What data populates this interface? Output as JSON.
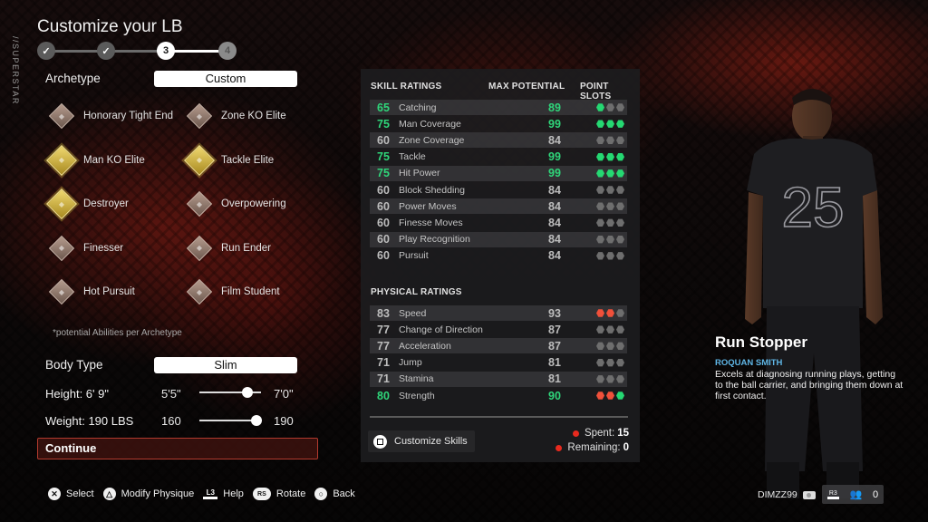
{
  "side_label": "//SUPERSTAR",
  "header": {
    "title": "Customize your LB",
    "steps": [
      {
        "label": "✓",
        "state": "done"
      },
      {
        "label": "✓",
        "state": "done"
      },
      {
        "label": "3",
        "state": "current"
      },
      {
        "label": "4",
        "state": "future"
      }
    ]
  },
  "archetype": {
    "label": "Archetype",
    "value": "Custom",
    "abilities": [
      {
        "name": "Honorary Tight End",
        "tier": "bronze"
      },
      {
        "name": "Zone KO Elite",
        "tier": "bronze"
      },
      {
        "name": "Man KO Elite",
        "tier": "gold"
      },
      {
        "name": "Tackle Elite",
        "tier": "gold"
      },
      {
        "name": "Destroyer",
        "tier": "gold"
      },
      {
        "name": "Overpowering",
        "tier": "bronze"
      },
      {
        "name": "Finesser",
        "tier": "bronze"
      },
      {
        "name": "Run Ender",
        "tier": "bronze"
      },
      {
        "name": "Hot Pursuit",
        "tier": "bronze"
      },
      {
        "name": "Film Student",
        "tier": "bronze"
      }
    ],
    "footnote": "*potential Abilities per Archetype"
  },
  "body": {
    "body_type_label": "Body Type",
    "body_type_value": "Slim",
    "height_label": "Height: 6' 9\"",
    "height_min": "5'5\"",
    "height_max": "7'0\"",
    "height_fraction": 0.78,
    "weight_label": "Weight: 190 LBS",
    "weight_min": "160",
    "weight_max": "190",
    "weight_fraction": 1.0,
    "continue_label": "Continue"
  },
  "ratings": {
    "skill_header": "SKILL RATINGS",
    "max_header": "MAX POTENTIAL",
    "slots_header": "POINT SLOTS",
    "skill": [
      {
        "current": "65",
        "name": "Catching",
        "max": "89",
        "up": true,
        "slots": [
          "g",
          "n",
          "n"
        ]
      },
      {
        "current": "75",
        "name": "Man Coverage",
        "max": "99",
        "up": true,
        "slots": [
          "g",
          "g",
          "g"
        ]
      },
      {
        "current": "60",
        "name": "Zone Coverage",
        "max": "84",
        "up": false,
        "slots": [
          "n",
          "n",
          "n"
        ]
      },
      {
        "current": "75",
        "name": "Tackle",
        "max": "99",
        "up": true,
        "slots": [
          "g",
          "g",
          "g"
        ]
      },
      {
        "current": "75",
        "name": "Hit Power",
        "max": "99",
        "up": true,
        "slots": [
          "g",
          "g",
          "g"
        ]
      },
      {
        "current": "60",
        "name": "Block Shedding",
        "max": "84",
        "up": false,
        "slots": [
          "n",
          "n",
          "n"
        ]
      },
      {
        "current": "60",
        "name": "Power Moves",
        "max": "84",
        "up": false,
        "slots": [
          "n",
          "n",
          "n"
        ]
      },
      {
        "current": "60",
        "name": "Finesse Moves",
        "max": "84",
        "up": false,
        "slots": [
          "n",
          "n",
          "n"
        ]
      },
      {
        "current": "60",
        "name": "Play Recognition",
        "max": "84",
        "up": false,
        "slots": [
          "n",
          "n",
          "n"
        ]
      },
      {
        "current": "60",
        "name": "Pursuit",
        "max": "84",
        "up": false,
        "slots": [
          "n",
          "n",
          "n"
        ]
      }
    ],
    "physical_header": "PHYSICAL RATINGS",
    "physical": [
      {
        "current": "83",
        "name": "Speed",
        "max": "93",
        "up": false,
        "slots": [
          "r",
          "r",
          "n"
        ]
      },
      {
        "current": "77",
        "name": "Change of Direction",
        "max": "87",
        "up": false,
        "slots": [
          "n",
          "n",
          "n"
        ]
      },
      {
        "current": "77",
        "name": "Acceleration",
        "max": "87",
        "up": false,
        "slots": [
          "n",
          "n",
          "n"
        ]
      },
      {
        "current": "71",
        "name": "Jump",
        "max": "81",
        "up": false,
        "slots": [
          "n",
          "n",
          "n"
        ]
      },
      {
        "current": "71",
        "name": "Stamina",
        "max": "81",
        "up": false,
        "slots": [
          "n",
          "n",
          "n"
        ]
      },
      {
        "current": "80",
        "name": "Strength",
        "max": "90",
        "up": true,
        "slots": [
          "r",
          "r",
          "g"
        ]
      }
    ],
    "customize_label": "Customize Skills",
    "spent_label": "Spent:",
    "spent_value": "15",
    "remaining_label": "Remaining:",
    "remaining_value": "0"
  },
  "player": {
    "jersey_number": "25",
    "archetype_title": "Run Stopper",
    "archetype_player": "ROQUAN SMITH",
    "archetype_desc": "Excels at diagnosing running plays, getting to the ball carrier, and bringing them down at first contact."
  },
  "hints": [
    {
      "icon": "cross-button-icon",
      "glyph": "✕",
      "label": "Select"
    },
    {
      "icon": "triangle-button-icon",
      "glyph": "△",
      "label": "Modify Physique"
    },
    {
      "icon": "l3-button-icon",
      "glyph": "L3",
      "label": "Help"
    },
    {
      "icon": "rs-button-icon",
      "glyph": "RS",
      "label": "Rotate"
    },
    {
      "icon": "circle-button-icon",
      "glyph": "○",
      "label": "Back"
    }
  ],
  "user": {
    "gamertag": "DIMZZ99",
    "party_button": "R3",
    "party_count": "0"
  }
}
